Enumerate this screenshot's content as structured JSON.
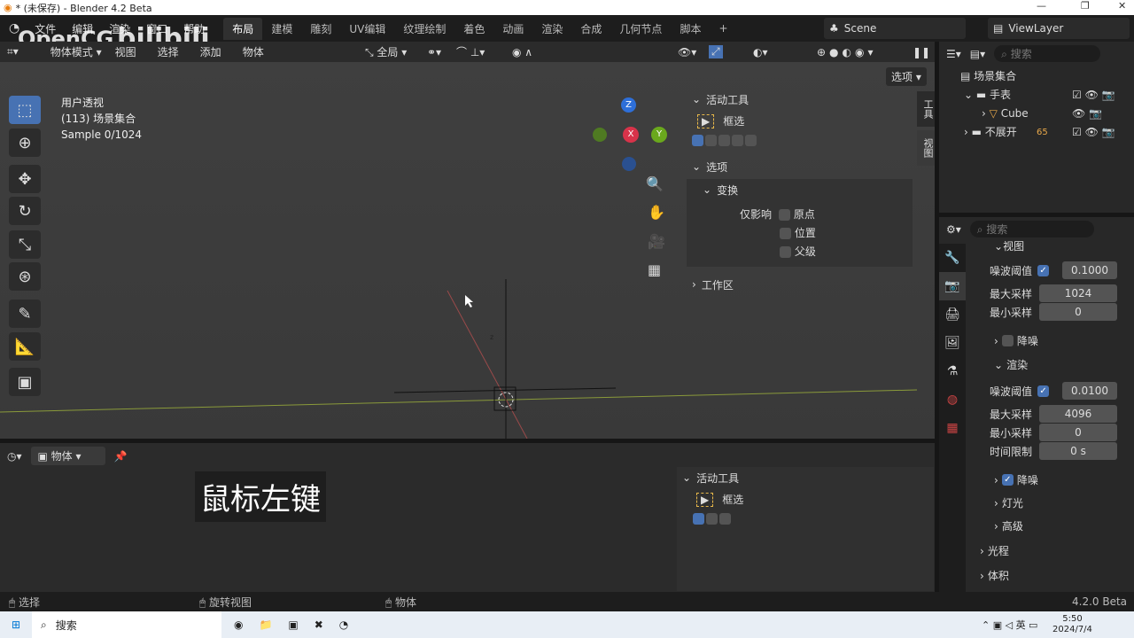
{
  "title": "* (未保存) - Blender 4.2 Beta",
  "menu": [
    "文件",
    "编辑",
    "渲染",
    "窗口",
    "帮助"
  ],
  "workspaces": [
    "布局",
    "建模",
    "雕刻",
    "UV编辑",
    "纹理绘制",
    "着色",
    "动画",
    "渲染",
    "合成",
    "几何节点",
    "脚本"
  ],
  "scene": "Scene",
  "view_layer": "ViewLayer",
  "watermark": {
    "logo": "OpenCG",
    "site": "bilibili"
  },
  "viewport_header": {
    "mode": "物体模式",
    "view": "视图",
    "select": "选择",
    "add": "添加",
    "object": "物体",
    "orientation": "全局",
    "options": "选项"
  },
  "overlay": {
    "view_name": "用户透视",
    "collection": "(113) 场景集合",
    "sample": "Sample 0/1024"
  },
  "gizmo": {
    "x": "X",
    "y": "Y",
    "z": "Z"
  },
  "npanel": {
    "active_tool": "活动工具",
    "tool_name": "框选",
    "options": "选项",
    "transform": "变换",
    "affect_only": "仅影响",
    "origin": "原点",
    "location": "位置",
    "parent": "父级",
    "workspace": "工作区",
    "tabs": [
      "工具",
      "视图"
    ]
  },
  "bottom": {
    "editor_mode": "物体",
    "subtitle": "鼠标左键",
    "active_tool": "活动工具",
    "tool_name": "框选"
  },
  "outliner": {
    "search_placeholder": "搜索",
    "items": [
      {
        "label": "场景集合"
      },
      {
        "label": "手表"
      },
      {
        "label": "Cube"
      },
      {
        "label": "不展开",
        "badge": "65"
      }
    ]
  },
  "props": {
    "search_placeholder": "搜索",
    "viewport_section": "视图",
    "noise_threshold": "噪波阈值",
    "viewport_noise": "0.1000",
    "max_samples": "最大采样",
    "viewport_max": "1024",
    "min_samples": "最小采样",
    "viewport_min": "0",
    "denoise": "降噪",
    "render_section": "渲染",
    "render_noise": "0.0100",
    "render_max": "4096",
    "render_min": "0",
    "time_limit": "时间限制",
    "render_time": "0 s",
    "lights": "灯光",
    "advanced": "高级",
    "light_paths": "光程",
    "volumes": "体积"
  },
  "status": {
    "select": "选择",
    "rotate": "旋转视图",
    "object": "物体",
    "version": "4.2.0 Beta"
  },
  "taskbar": {
    "search": "搜索",
    "lang": "英",
    "time": "5:50",
    "date": "2024/7/4"
  }
}
